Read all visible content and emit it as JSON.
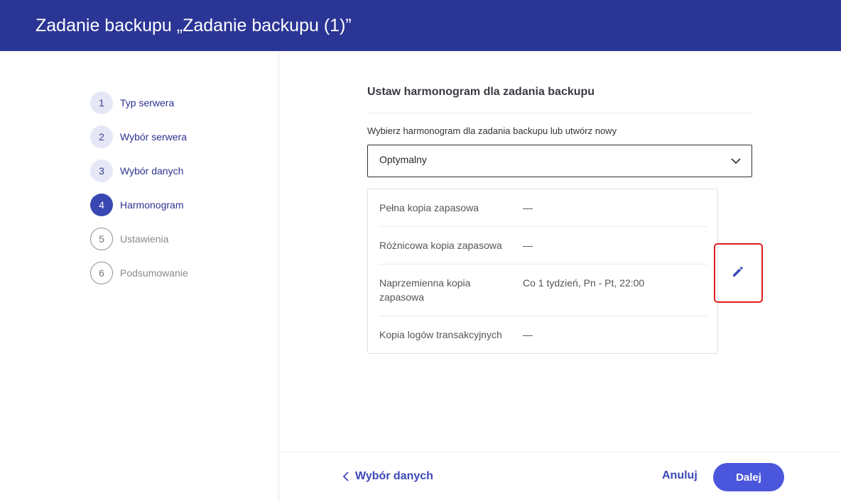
{
  "window": {
    "title": "Zadanie backupu „Zadanie backupu (1)”"
  },
  "steps": [
    {
      "num": "1",
      "label": "Typ serwera",
      "state": "done"
    },
    {
      "num": "2",
      "label": "Wybór serwera",
      "state": "done"
    },
    {
      "num": "3",
      "label": "Wybór danych",
      "state": "done"
    },
    {
      "num": "4",
      "label": "Harmonogram",
      "state": "active"
    },
    {
      "num": "5",
      "label": "Ustawienia",
      "state": "todo"
    },
    {
      "num": "6",
      "label": "Podsumowanie",
      "state": "todo"
    }
  ],
  "main": {
    "section_title": "Ustaw harmonogram dla zadania backupu",
    "select_label": "Wybierz harmonogram dla zadania backupu lub utwórz nowy",
    "select_value": "Optymalny",
    "schedule": [
      {
        "label": "Pełna kopia zapasowa",
        "value": "—"
      },
      {
        "label": "Różnicowa kopia zapasowa",
        "value": "—"
      },
      {
        "label": "Naprzemienna kopia zapasowa",
        "value": "Co 1 tydzień, Pn - Pt, 22:00"
      },
      {
        "label": "Kopia logów transakcyjnych",
        "value": "—"
      }
    ]
  },
  "footer": {
    "back_label": "Wybór danych",
    "cancel_label": "Anuluj",
    "next_label": "Dalej"
  },
  "colors": {
    "header_bg": "#2b3595",
    "accent": "#4a56dc",
    "highlight_border": "#e01c1c"
  },
  "icons": [
    "chevron-down-icon",
    "pencil-icon",
    "chevron-left-icon"
  ]
}
